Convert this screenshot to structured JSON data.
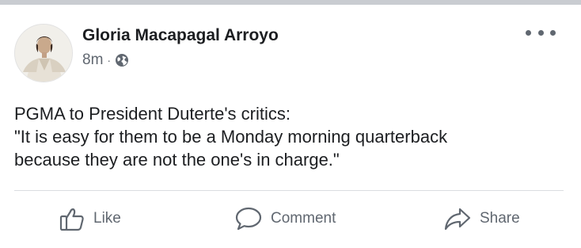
{
  "post": {
    "author": "Gloria Macapagal Arroyo",
    "time": "8m",
    "separator": "·",
    "privacy_icon": "globe-icon",
    "more_icon": "more-options-icon",
    "text_lines": [
      "PGMA to President Duterte's critics:",
      "\"It is easy for them to be a Monday morning quarterback",
      "because they are not the one's in charge.\""
    ]
  },
  "actions": {
    "like": {
      "label": "Like",
      "icon": "thumbs-up-icon"
    },
    "comment": {
      "label": "Comment",
      "icon": "comment-bubble-icon"
    },
    "share": {
      "label": "Share",
      "icon": "share-arrow-icon"
    }
  },
  "colors": {
    "text_primary": "#1c1e21",
    "text_secondary": "#606770",
    "divider": "#dadde1",
    "top_strip": "#c9ccd1"
  }
}
